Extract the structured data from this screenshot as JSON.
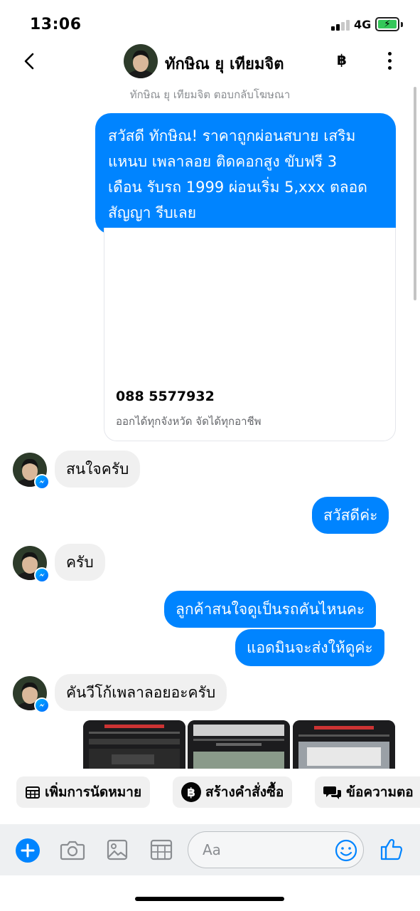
{
  "status_bar": {
    "time": "13:06",
    "network": "4G"
  },
  "header": {
    "contact_name": "ทักษิณ ยุ เทียมจิต",
    "payment_symbol": "฿"
  },
  "subheader": "ทักษิณ ยุ เทียมจิต ตอบกลับโฆษณา",
  "messages": {
    "ad_text": "สวัสดี ทักษิณ! ราคาถูกผ่อนสบาย เสริม แหนบ เพลาลอย ติดคอกสูง ขับฟรี 3 เดือน รับรถ 1999 ผ่อนเริ่ม 5,xxx ตลอดสัญญา รีบเลย",
    "ad_text_lines": [
      "สวัสดี ทักษิณ! ราคาถูกผ่อนสบาย เสริม",
      "แหนบ เพลาลอย ติดคอกสูง ขับฟรี 3",
      "เดือน รับรถ 1999 ผ่อนเริ่ม 5,xxx ตลอด",
      "สัญญา รีบเลย"
    ],
    "ad_phone": "088 5577932",
    "ad_caption": "ออกได้ทุกจังหวัด จัดได้ทุกอาชีพ",
    "m1": "สนใจครับ",
    "m2": "สวัสดีค่ะ",
    "m3": "ครับ",
    "m4": "ลูกค้าสนใจดูเป็นรถคันไหนคะ",
    "m5": "แอดมินจะส่งให้ดูค่ะ",
    "m6": "คันวีโก้เพลาลอยอะครับ"
  },
  "actions": {
    "appointment": "เพิ่มการนัดหมาย",
    "create_order": "สร้างคำสั่งซื้อ",
    "saved_reply": "ข้อความตอ"
  },
  "composer": {
    "placeholder": "Aa"
  },
  "colors": {
    "accent": "#0084ff",
    "incoming_bubble": "#f0f0f0"
  }
}
